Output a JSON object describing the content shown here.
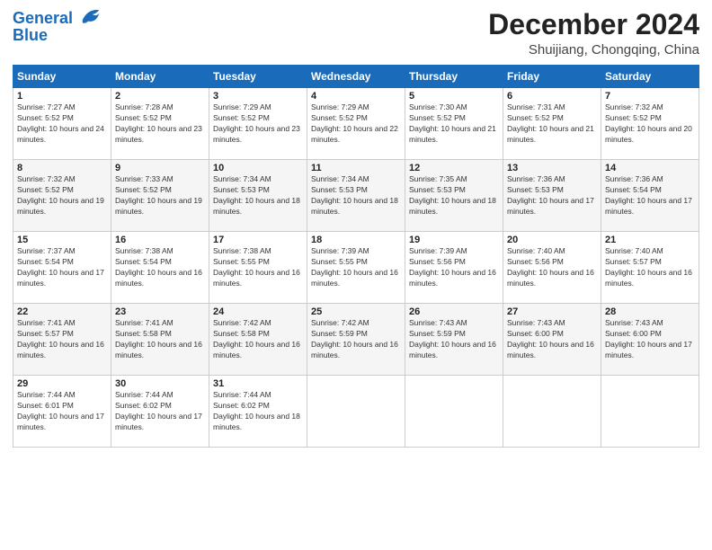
{
  "logo": {
    "line1": "General",
    "line2": "Blue"
  },
  "title": "December 2024",
  "location": "Shuijiang, Chongqing, China",
  "days_of_week": [
    "Sunday",
    "Monday",
    "Tuesday",
    "Wednesday",
    "Thursday",
    "Friday",
    "Saturday"
  ],
  "weeks": [
    [
      {
        "day": 1,
        "sunrise": "7:27 AM",
        "sunset": "5:52 PM",
        "daylight": "10 hours and 24 minutes."
      },
      {
        "day": 2,
        "sunrise": "7:28 AM",
        "sunset": "5:52 PM",
        "daylight": "10 hours and 23 minutes."
      },
      {
        "day": 3,
        "sunrise": "7:29 AM",
        "sunset": "5:52 PM",
        "daylight": "10 hours and 23 minutes."
      },
      {
        "day": 4,
        "sunrise": "7:29 AM",
        "sunset": "5:52 PM",
        "daylight": "10 hours and 22 minutes."
      },
      {
        "day": 5,
        "sunrise": "7:30 AM",
        "sunset": "5:52 PM",
        "daylight": "10 hours and 21 minutes."
      },
      {
        "day": 6,
        "sunrise": "7:31 AM",
        "sunset": "5:52 PM",
        "daylight": "10 hours and 21 minutes."
      },
      {
        "day": 7,
        "sunrise": "7:32 AM",
        "sunset": "5:52 PM",
        "daylight": "10 hours and 20 minutes."
      }
    ],
    [
      {
        "day": 8,
        "sunrise": "7:32 AM",
        "sunset": "5:52 PM",
        "daylight": "10 hours and 19 minutes."
      },
      {
        "day": 9,
        "sunrise": "7:33 AM",
        "sunset": "5:52 PM",
        "daylight": "10 hours and 19 minutes."
      },
      {
        "day": 10,
        "sunrise": "7:34 AM",
        "sunset": "5:53 PM",
        "daylight": "10 hours and 18 minutes."
      },
      {
        "day": 11,
        "sunrise": "7:34 AM",
        "sunset": "5:53 PM",
        "daylight": "10 hours and 18 minutes."
      },
      {
        "day": 12,
        "sunrise": "7:35 AM",
        "sunset": "5:53 PM",
        "daylight": "10 hours and 18 minutes."
      },
      {
        "day": 13,
        "sunrise": "7:36 AM",
        "sunset": "5:53 PM",
        "daylight": "10 hours and 17 minutes."
      },
      {
        "day": 14,
        "sunrise": "7:36 AM",
        "sunset": "5:54 PM",
        "daylight": "10 hours and 17 minutes."
      }
    ],
    [
      {
        "day": 15,
        "sunrise": "7:37 AM",
        "sunset": "5:54 PM",
        "daylight": "10 hours and 17 minutes."
      },
      {
        "day": 16,
        "sunrise": "7:38 AM",
        "sunset": "5:54 PM",
        "daylight": "10 hours and 16 minutes."
      },
      {
        "day": 17,
        "sunrise": "7:38 AM",
        "sunset": "5:55 PM",
        "daylight": "10 hours and 16 minutes."
      },
      {
        "day": 18,
        "sunrise": "7:39 AM",
        "sunset": "5:55 PM",
        "daylight": "10 hours and 16 minutes."
      },
      {
        "day": 19,
        "sunrise": "7:39 AM",
        "sunset": "5:56 PM",
        "daylight": "10 hours and 16 minutes."
      },
      {
        "day": 20,
        "sunrise": "7:40 AM",
        "sunset": "5:56 PM",
        "daylight": "10 hours and 16 minutes."
      },
      {
        "day": 21,
        "sunrise": "7:40 AM",
        "sunset": "5:57 PM",
        "daylight": "10 hours and 16 minutes."
      }
    ],
    [
      {
        "day": 22,
        "sunrise": "7:41 AM",
        "sunset": "5:57 PM",
        "daylight": "10 hours and 16 minutes."
      },
      {
        "day": 23,
        "sunrise": "7:41 AM",
        "sunset": "5:58 PM",
        "daylight": "10 hours and 16 minutes."
      },
      {
        "day": 24,
        "sunrise": "7:42 AM",
        "sunset": "5:58 PM",
        "daylight": "10 hours and 16 minutes."
      },
      {
        "day": 25,
        "sunrise": "7:42 AM",
        "sunset": "5:59 PM",
        "daylight": "10 hours and 16 minutes."
      },
      {
        "day": 26,
        "sunrise": "7:43 AM",
        "sunset": "5:59 PM",
        "daylight": "10 hours and 16 minutes."
      },
      {
        "day": 27,
        "sunrise": "7:43 AM",
        "sunset": "6:00 PM",
        "daylight": "10 hours and 16 minutes."
      },
      {
        "day": 28,
        "sunrise": "7:43 AM",
        "sunset": "6:00 PM",
        "daylight": "10 hours and 17 minutes."
      }
    ],
    [
      {
        "day": 29,
        "sunrise": "7:44 AM",
        "sunset": "6:01 PM",
        "daylight": "10 hours and 17 minutes."
      },
      {
        "day": 30,
        "sunrise": "7:44 AM",
        "sunset": "6:02 PM",
        "daylight": "10 hours and 17 minutes."
      },
      {
        "day": 31,
        "sunrise": "7:44 AM",
        "sunset": "6:02 PM",
        "daylight": "10 hours and 18 minutes."
      },
      null,
      null,
      null,
      null
    ]
  ]
}
